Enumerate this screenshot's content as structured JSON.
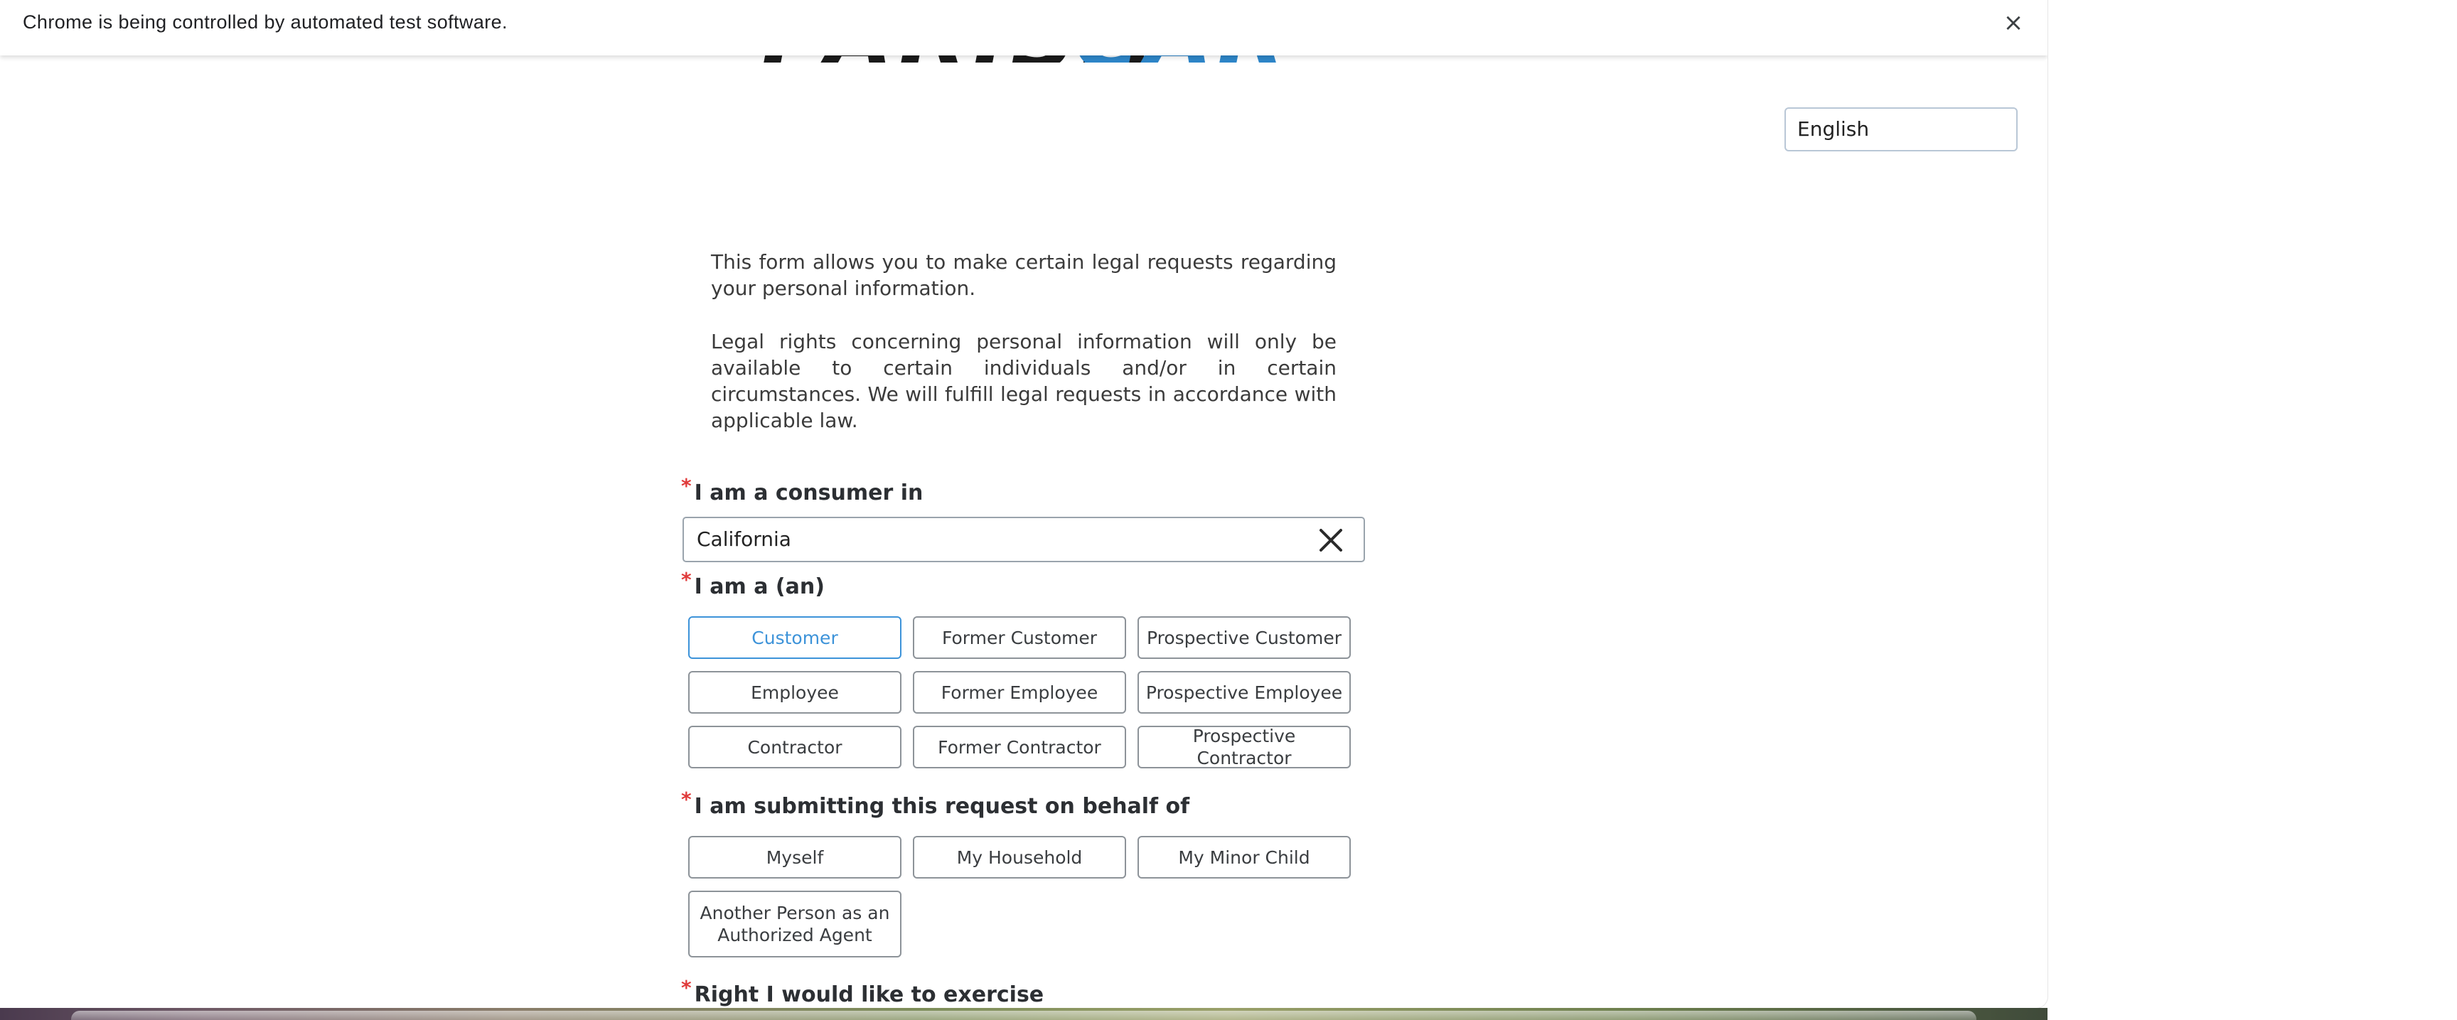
{
  "infobar": {
    "message": "Chrome is being controlled by automated test software.",
    "close_glyph": "×"
  },
  "logo": {
    "part1": "PARISH",
    "part2": "CARE"
  },
  "language": {
    "selected": "English"
  },
  "intro": {
    "paragraph1": "This form allows you to make certain legal requests regarding your personal information.",
    "paragraph2": "Legal rights concerning personal information will only be available to certain individuals and/or in certain circumstances. We will fulfill legal requests in accordance with applicable law."
  },
  "questions": {
    "consumer_in": {
      "required_mark": "*",
      "label": "I am a consumer in",
      "value": "California"
    },
    "i_am_a": {
      "required_mark": "*",
      "label": "I am a (an)",
      "selected": "Customer",
      "options": [
        "Customer",
        "Former Customer",
        "Prospective Customer",
        "Employee",
        "Former Employee",
        "Prospective Employee",
        "Contractor",
        "Former Contractor",
        "Prospective Contractor"
      ]
    },
    "on_behalf_of": {
      "required_mark": "*",
      "label": "I am submitting this request on behalf of",
      "options": [
        "Myself",
        "My Household",
        "My Minor Child",
        "Another Person as an Authorized Agent"
      ]
    },
    "right_to_exercise": {
      "required_mark": "*",
      "label": "Right I would like to exercise"
    }
  },
  "colors": {
    "accent": "#3d93d9",
    "required": "#e03a3a",
    "border": "#8d9399"
  }
}
